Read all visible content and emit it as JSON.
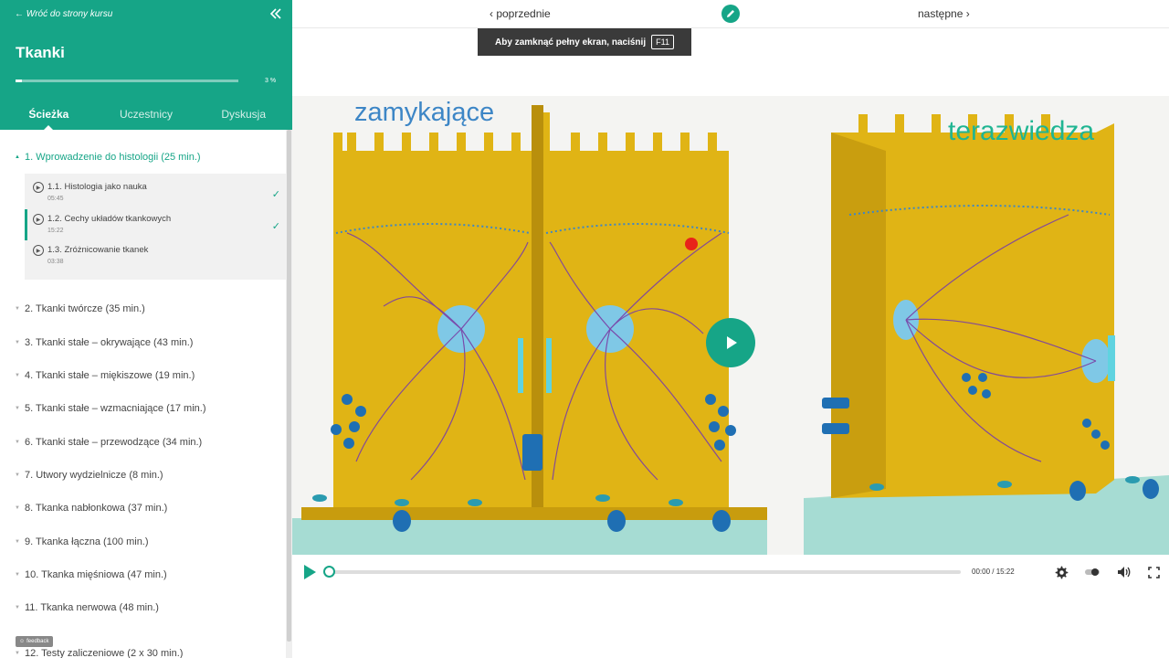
{
  "sidebar": {
    "back_label": "← Wróć do strony kursu",
    "course_title": "Tkanki",
    "progress_percent": 3,
    "progress_label": "3 %",
    "tabs": [
      {
        "label": "Ścieżka",
        "active": true
      },
      {
        "label": "Uczestnicy",
        "active": false
      },
      {
        "label": "Dyskusja",
        "active": false
      }
    ],
    "open_section": {
      "label": "1. Wprowadzenie do histologii (25 min.)",
      "lessons": [
        {
          "title": "1.1. Histologia jako nauka",
          "duration": "05:45",
          "completed": true
        },
        {
          "title": "1.2. Cechy układów tkankowych",
          "duration": "15:22",
          "completed": true,
          "current": true
        },
        {
          "title": "1.3. Zróżnicowanie tkanek",
          "duration": "03:38",
          "completed": false
        }
      ]
    },
    "sections": [
      "2. Tkanki twórcze (35 min.)",
      "3. Tkanki stałe – okrywające (43 min.)",
      "4. Tkanki stałe – miękiszowe (19 min.)",
      "5. Tkanki stałe – wzmacniające (17 min.)",
      "6. Tkanki stałe – przewodzące (34 min.)",
      "7. Utwory wydzielnicze (8 min.)",
      "8. Tkanka nabłonkowa (37 min.)",
      "9. Tkanka łączna (100 min.)",
      "10. Tkanka mięśniowa (47 min.)",
      "11. Tkanka nerwowa (48 min.)",
      "12. Testy zaliczeniowe (2 x 30 min.)"
    ],
    "feedback_label": "feedback"
  },
  "nav": {
    "prev_label": "‹ poprzednie",
    "next_label": "następne ›"
  },
  "toast": {
    "text": "Aby zamknąć pełny ekran, naciśnij",
    "key": "F11"
  },
  "video": {
    "watermark_left": "zamykające",
    "watermark_right": "terazwiedza",
    "time_label": "00:00 / 15:22",
    "progress_percent": 0
  },
  "colors": {
    "brand": "#16a587",
    "cell": "#e0b415",
    "cell_dark": "#b98f0c",
    "fiber": "#7a3fa5",
    "base": "#a6dcd3"
  },
  "icons": [
    "double-chevron-left-icon",
    "pencil-icon",
    "play-icon",
    "gear-icon",
    "toggle-icon",
    "speaker-icon",
    "fullscreen-icon",
    "check-icon"
  ]
}
